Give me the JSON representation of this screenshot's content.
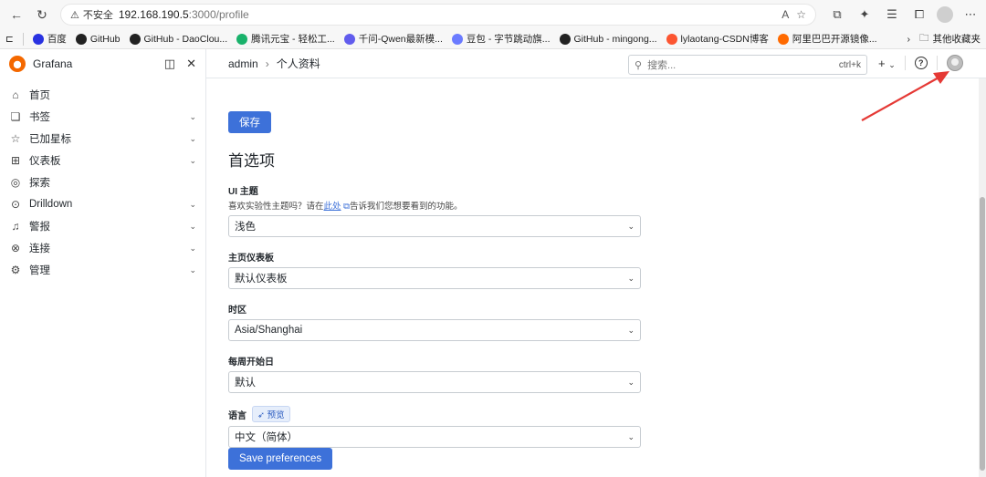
{
  "browser": {
    "security_label": "不安全",
    "url_host": "192.168.190.5",
    "url_path": ":3000/profile"
  },
  "bookmarks": [
    {
      "label": "百度",
      "color": "#2932e1"
    },
    {
      "label": "GitHub",
      "color": "#222222"
    },
    {
      "label": "GitHub - DaoClou...",
      "color": "#222222"
    },
    {
      "label": "腾讯元宝 - 轻松工...",
      "color": "#19b26b"
    },
    {
      "label": "千问-Qwen最新模...",
      "color": "#615ced"
    },
    {
      "label": "豆包 - 字节跳动旗...",
      "color": "#6b7bff"
    },
    {
      "label": "GitHub - mingong...",
      "color": "#222222"
    },
    {
      "label": "lylaotang-CSDN博客",
      "color": "#fc5531"
    },
    {
      "label": "阿里巴巴开源镜像...",
      "color": "#ff6a00"
    }
  ],
  "bookmarks_other": "其他收藏夹",
  "sidebar": {
    "title": "Grafana",
    "items": [
      {
        "label": "首页",
        "icon": "home-icon",
        "glyph": "⌂",
        "expandable": false
      },
      {
        "label": "书签",
        "icon": "bookmark-icon",
        "glyph": "❏",
        "expandable": true
      },
      {
        "label": "已加星标",
        "icon": "star-icon",
        "glyph": "☆",
        "expandable": true
      },
      {
        "label": "仪表板",
        "icon": "dashboard-icon",
        "glyph": "⊞",
        "expandable": true
      },
      {
        "label": "探索",
        "icon": "compass-icon",
        "glyph": "◎",
        "expandable": false
      },
      {
        "label": "Drilldown",
        "icon": "drilldown-icon",
        "glyph": "⊙",
        "expandable": true
      },
      {
        "label": "警报",
        "icon": "bell-icon",
        "glyph": "♫",
        "expandable": true
      },
      {
        "label": "连接",
        "icon": "link-icon",
        "glyph": "⊗",
        "expandable": true
      },
      {
        "label": "管理",
        "icon": "gear-icon",
        "glyph": "⚙",
        "expandable": true
      }
    ]
  },
  "topbar": {
    "breadcrumb": [
      "admin",
      "个人资料"
    ],
    "search_placeholder": "搜索...",
    "search_shortcut": "ctrl+k",
    "add_label": "+"
  },
  "form": {
    "save_label": "保存",
    "section_title": "首选项",
    "theme": {
      "label": "UI 主题",
      "desc_before": "喜欢实验性主题吗？请在",
      "desc_link": "此处",
      "desc_after": "告诉我们您想要看到的功能。",
      "value": "浅色"
    },
    "home_dashboard": {
      "label": "主页仪表板",
      "value": "默认仪表板"
    },
    "timezone": {
      "label": "时区",
      "value": "Asia/Shanghai"
    },
    "week_start": {
      "label": "每周开始日",
      "value": "默认"
    },
    "language": {
      "label": "语言",
      "badge": "预览",
      "value": "中文（简体）"
    },
    "save_preferences_label": "Save preferences"
  },
  "colors": {
    "primary": "#3d71d9",
    "arrow": "#e53935",
    "logo": "#f46800"
  }
}
